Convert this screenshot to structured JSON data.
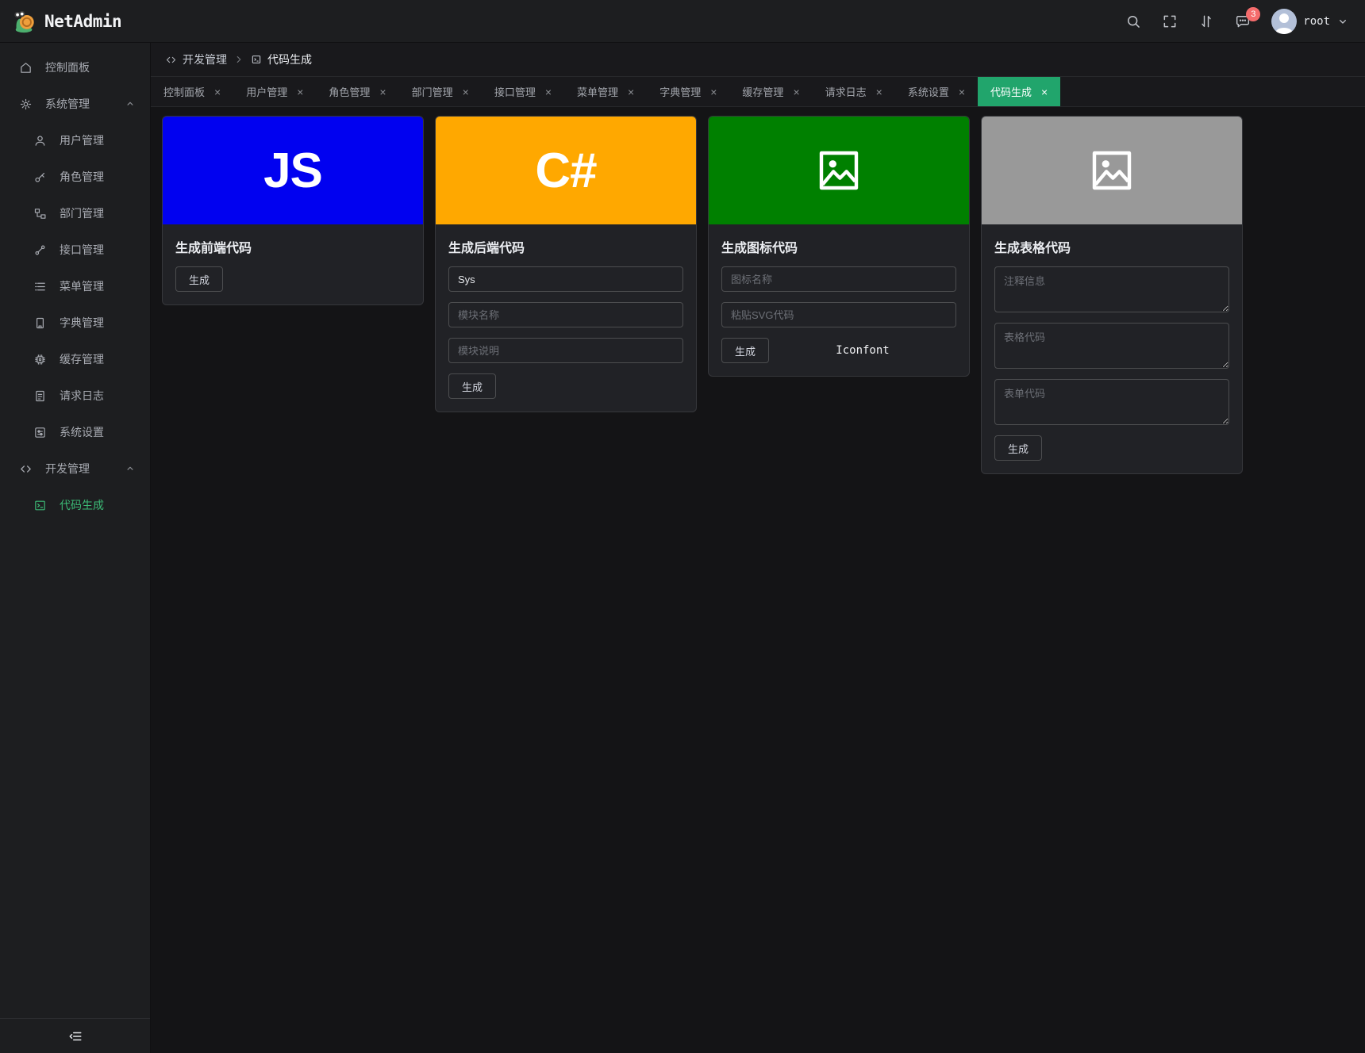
{
  "header": {
    "brand": "NetAdmin",
    "notification_count": "3",
    "username": "root"
  },
  "sidebar": {
    "items": [
      {
        "label": "控制面板"
      },
      {
        "label": "系统管理"
      },
      {
        "label": "用户管理"
      },
      {
        "label": "角色管理"
      },
      {
        "label": "部门管理"
      },
      {
        "label": "接口管理"
      },
      {
        "label": "菜单管理"
      },
      {
        "label": "字典管理"
      },
      {
        "label": "缓存管理"
      },
      {
        "label": "请求日志"
      },
      {
        "label": "系统设置"
      },
      {
        "label": "开发管理"
      },
      {
        "label": "代码生成"
      }
    ]
  },
  "breadcrumb": {
    "parent": "开发管理",
    "current": "代码生成"
  },
  "tabs": [
    {
      "label": "控制面板"
    },
    {
      "label": "用户管理"
    },
    {
      "label": "角色管理"
    },
    {
      "label": "部门管理"
    },
    {
      "label": "接口管理"
    },
    {
      "label": "菜单管理"
    },
    {
      "label": "字典管理"
    },
    {
      "label": "缓存管理"
    },
    {
      "label": "请求日志"
    },
    {
      "label": "系统设置"
    },
    {
      "label": "代码生成"
    }
  ],
  "cards": {
    "frontend": {
      "title": "生成前端代码",
      "banner_text": "JS",
      "banner_color": "#0101f0",
      "generate_label": "生成"
    },
    "backend": {
      "title": "生成后端代码",
      "banner_text": "C#",
      "banner_color": "#ffa800",
      "namespace_value": "Sys",
      "module_name_placeholder": "模块名称",
      "module_desc_placeholder": "模块说明",
      "generate_label": "生成"
    },
    "icon": {
      "title": "生成图标代码",
      "banner_color": "#008000",
      "icon_name_placeholder": "图标名称",
      "svg_placeholder": "粘贴SVG代码",
      "generate_label": "生成",
      "link_label": "Iconfont"
    },
    "table": {
      "title": "生成表格代码",
      "banner_color": "#999999",
      "comment_placeholder": "注释信息",
      "table_code_placeholder": "表格代码",
      "form_code_placeholder": "表单代码",
      "generate_label": "生成"
    }
  },
  "colors": {
    "active_tab_green": "#21a56c",
    "sidebar_active_green": "#3cba76",
    "badge_red": "#f56c6c"
  }
}
